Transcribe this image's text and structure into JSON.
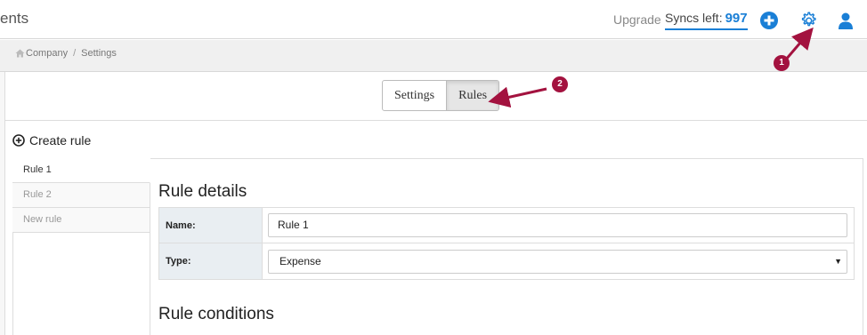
{
  "header": {
    "app_title": "ents",
    "upgrade_label": "Upgrade",
    "syncs_label": "Syncs left:",
    "syncs_count": "997",
    "accent_color": "#1a7fd6",
    "icons": [
      "plus-circle-icon",
      "gear-icon",
      "user-icon"
    ]
  },
  "breadcrumb": {
    "items": [
      "Company",
      "Settings"
    ],
    "separator": "/"
  },
  "tabs": {
    "settings_label": "Settings",
    "rules_label": "Rules",
    "active": "Rules"
  },
  "create_rule": {
    "label": "Create rule"
  },
  "rules": {
    "items": [
      "Rule 1",
      "Rule 2",
      "New rule"
    ],
    "selected": "Rule 1"
  },
  "rule_details": {
    "heading": "Rule details",
    "name_label": "Name:",
    "name_value": "Rule 1",
    "type_label": "Type:",
    "type_value": "Expense"
  },
  "rule_conditions": {
    "heading": "Rule conditions"
  },
  "annotations": {
    "callout_1": "1",
    "callout_2": "2",
    "color": "#a3123f"
  }
}
